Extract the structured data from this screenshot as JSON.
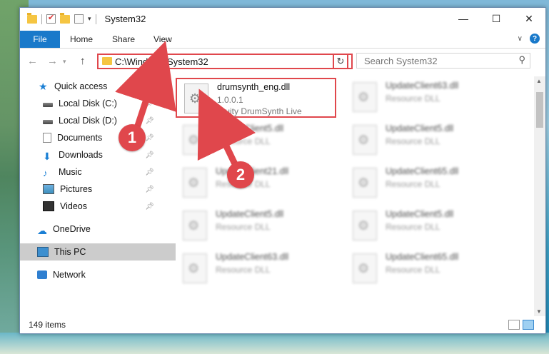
{
  "window": {
    "title": "System32"
  },
  "window_controls": {
    "minimize": "—",
    "maximize": "☐",
    "close": "✕"
  },
  "ribbon": {
    "file": "File",
    "tabs": [
      "Home",
      "Share",
      "View"
    ]
  },
  "address_bar": {
    "path": "C:\\Windows\\System32"
  },
  "search": {
    "placeholder": "Search System32"
  },
  "sidebar": {
    "items": [
      {
        "label": "Quick access",
        "icon": "star-icon"
      },
      {
        "label": "Local Disk (C:)",
        "icon": "drive-icon",
        "pinned": true
      },
      {
        "label": "Local Disk (D:)",
        "icon": "drive-icon",
        "pinned": true
      },
      {
        "label": "Documents",
        "icon": "documents-icon",
        "pinned": true
      },
      {
        "label": "Downloads",
        "icon": "downloads-icon",
        "pinned": true
      },
      {
        "label": "Music",
        "icon": "music-icon",
        "pinned": true
      },
      {
        "label": "Pictures",
        "icon": "pictures-icon",
        "pinned": true
      },
      {
        "label": "Videos",
        "icon": "videos-icon",
        "pinned": true
      },
      {
        "label": "OneDrive",
        "icon": "onedrive-icon"
      },
      {
        "label": "This PC",
        "icon": "this-pc-icon",
        "selected": true
      },
      {
        "label": "Network",
        "icon": "network-icon"
      }
    ]
  },
  "files": [
    {
      "name": "drumsynth_eng.dll",
      "line2": "1.0.0.1",
      "line3": "Fruity DrumSynth Live",
      "highlighted": true
    },
    {
      "name": "UpdateClient63.dll",
      "line2": "Resource DLL"
    },
    {
      "name": "UpdateClient5.dll",
      "line2": "Resource DLL"
    },
    {
      "name": "UpdateClient5.dll",
      "line2": "Resource DLL"
    },
    {
      "name": "UpdateClient21.dll",
      "line2": "Resource DLL"
    },
    {
      "name": "UpdateClient65.dll",
      "line2": "Resource DLL"
    },
    {
      "name": "UpdateClient5.dll",
      "line2": "Resource DLL"
    },
    {
      "name": "UpdateClient5.dll",
      "line2": "Resource DLL"
    },
    {
      "name": "UpdateClient63.dll",
      "line2": "Resource DLL"
    },
    {
      "name": "UpdateClient65.dll",
      "line2": "Resource DLL"
    }
  ],
  "status": {
    "item_count": "149 items"
  },
  "annotations": {
    "badge1": "1",
    "badge2": "2",
    "color": "#e0474c"
  }
}
